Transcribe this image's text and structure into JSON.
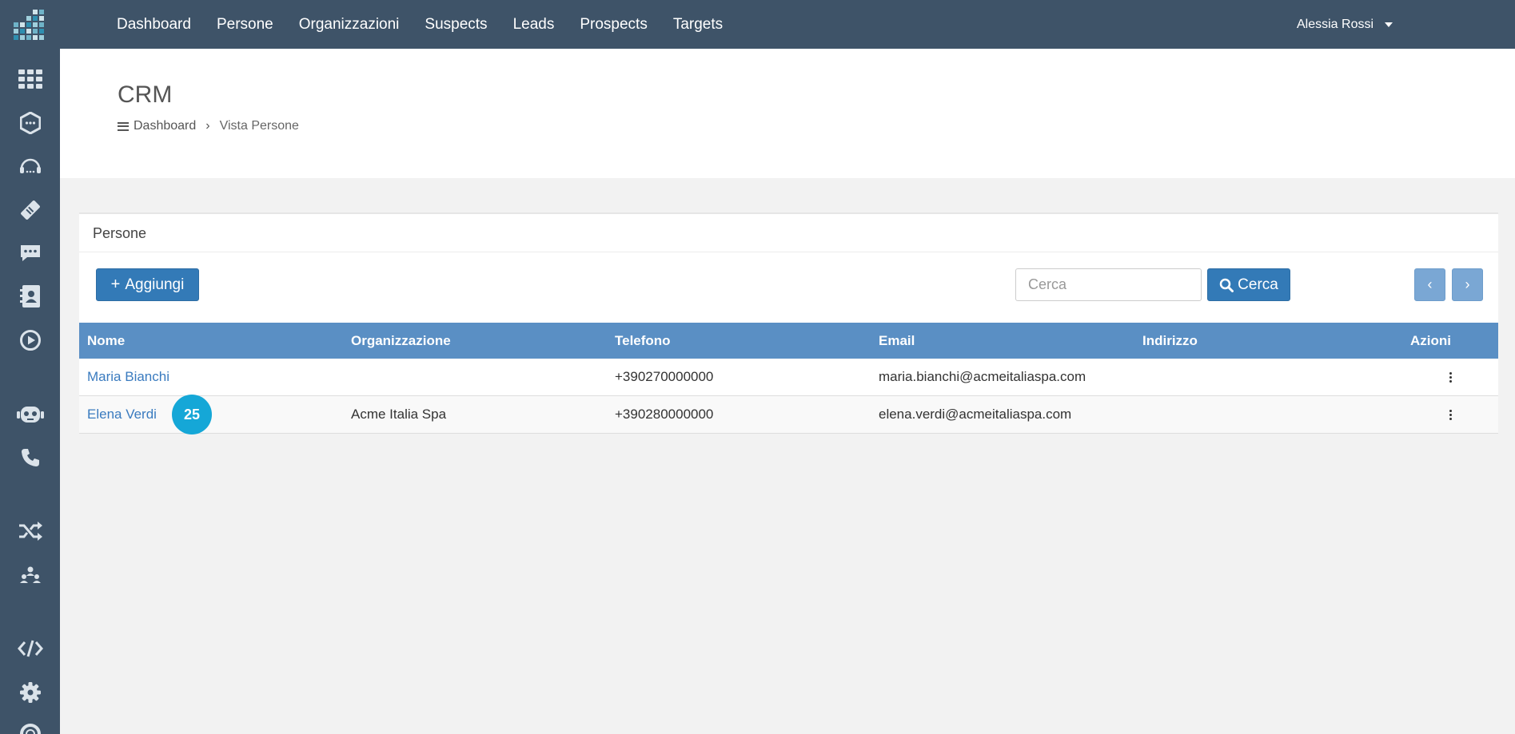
{
  "nav": {
    "items": [
      "Dashboard",
      "Persone",
      "Organizzazioni",
      "Suspects",
      "Leads",
      "Prospects",
      "Targets"
    ],
    "user_name": "Alessia Rossi"
  },
  "sidebar": {
    "icons": [
      "grid-icon",
      "hexagon-chat-icon",
      "headset-icon",
      "ticket-icon",
      "message-bubble-icon",
      "contact-card-icon",
      "play-icon",
      "robot-icon",
      "phone-icon",
      "shuffle-icon",
      "team-icon",
      "code-icon",
      "gear-icon",
      "lifebuoy-icon"
    ]
  },
  "header": {
    "title": "CRM",
    "breadcrumb": {
      "home": "Dashboard",
      "current": "Vista Persone"
    }
  },
  "panel": {
    "title": "Persone",
    "add_label": "Aggiungi",
    "search_placeholder": "Cerca",
    "search_button": "Cerca",
    "prev_label": "‹",
    "next_label": "›"
  },
  "table": {
    "columns": [
      "Nome",
      "Organizzazione",
      "Telefono",
      "Email",
      "Indirizzo",
      "Azioni"
    ],
    "rows": [
      {
        "nome": "Maria Bianchi",
        "organizzazione": "",
        "telefono": "+390270000000",
        "email": "maria.bianchi@acmeitaliaspa.com",
        "indirizzo": ""
      },
      {
        "nome": "Elena Verdi",
        "organizzazione": "Acme Italia Spa",
        "telefono": "+390280000000",
        "email": "elena.verdi@acmeitaliaspa.com",
        "indirizzo": ""
      }
    ]
  },
  "overlay": {
    "badge": "25"
  },
  "colors": {
    "topbar": "#3e5368",
    "primary": "#337ab7",
    "table_header": "#5a8fc4",
    "link": "#3a7bbf",
    "badge": "#15a7d7"
  }
}
